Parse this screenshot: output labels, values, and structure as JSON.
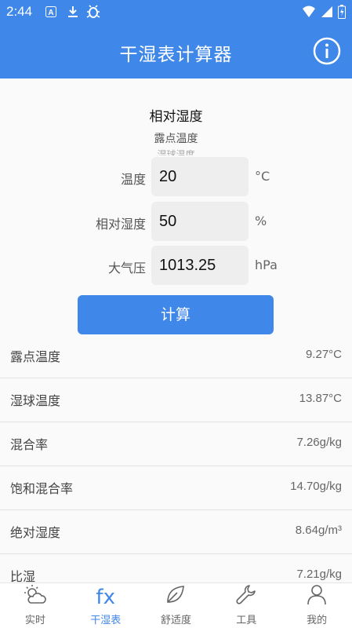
{
  "statusbar": {
    "time": "2:44"
  },
  "appbar": {
    "title": "干湿表计算器"
  },
  "picker": {
    "selected": "相对湿度",
    "option2": "露点温度",
    "option3": "湿球温度"
  },
  "inputs": [
    {
      "label": "温度",
      "value": "20",
      "unit": "°C"
    },
    {
      "label": "相对湿度",
      "value": "50",
      "unit": "%"
    },
    {
      "label": "大气压",
      "value": "1013.25",
      "unit": "hPa"
    }
  ],
  "calc_button": "计算",
  "results": [
    {
      "label": "露点温度",
      "value": "9.27°C"
    },
    {
      "label": "湿球温度",
      "value": "13.87°C"
    },
    {
      "label": "混合率",
      "value": "7.26g/kg"
    },
    {
      "label": "饱和混合率",
      "value": "14.70g/kg"
    },
    {
      "label": "绝对湿度",
      "value": "8.64g/m³"
    },
    {
      "label": "比湿",
      "value": "7.21g/kg"
    }
  ],
  "tabs": [
    {
      "label": "实时",
      "icon": "weather-icon"
    },
    {
      "label": "干湿表",
      "icon": "fx-icon",
      "icon_text": "fx"
    },
    {
      "label": "舒适度",
      "icon": "leaf-icon"
    },
    {
      "label": "工具",
      "icon": "wrench-icon"
    },
    {
      "label": "我的",
      "icon": "person-icon"
    }
  ],
  "colors": {
    "primary": "#3f87e8",
    "background": "#fafafa"
  }
}
